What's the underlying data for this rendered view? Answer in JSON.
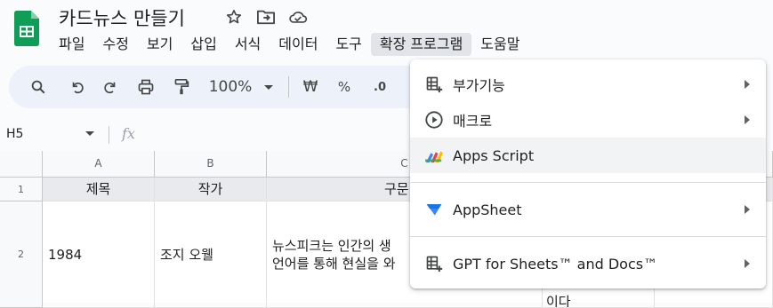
{
  "app": {
    "doc_title": "카드뉴스 만들기",
    "icons": [
      "star-icon",
      "move-to-folder-icon",
      "cloud-status-icon"
    ],
    "brand_color": "#0f9d58"
  },
  "menubar": [
    "파일",
    "수정",
    "보기",
    "삽입",
    "서식",
    "데이터",
    "도구",
    "확장 프로그램",
    "도움말"
  ],
  "toolbar": {
    "zoom": "100%",
    "currency": "₩",
    "percent": "%",
    "decimal": ".0"
  },
  "formula_bar": {
    "name_box": "H5",
    "fx": "fx",
    "value": ""
  },
  "grid": {
    "columns": [
      "A",
      "B",
      "C"
    ],
    "rows": [
      {
        "num": "1",
        "cells": [
          "제목",
          "작가",
          "구문"
        ]
      },
      {
        "num": "2",
        "cells": [
          "1984",
          "조지 오웰",
          "뉴스피크는 인간의 생",
          "언어를 통해 현실을 와"
        ]
      }
    ],
    "overflow_text": "이다"
  },
  "extensions_menu": {
    "items": [
      {
        "label": "부가기능",
        "icon": "add-ons-icon",
        "submenu": true
      },
      {
        "label": "매크로",
        "icon": "macro-play-icon",
        "submenu": true
      },
      {
        "label": "Apps Script",
        "icon": "apps-script-icon",
        "submenu": false
      },
      {
        "label": "AppSheet",
        "icon": "appsheet-icon",
        "submenu": true
      },
      {
        "label": "GPT for Sheets™ and Docs™",
        "icon": "gpt-addon-icon",
        "submenu": true
      }
    ]
  }
}
